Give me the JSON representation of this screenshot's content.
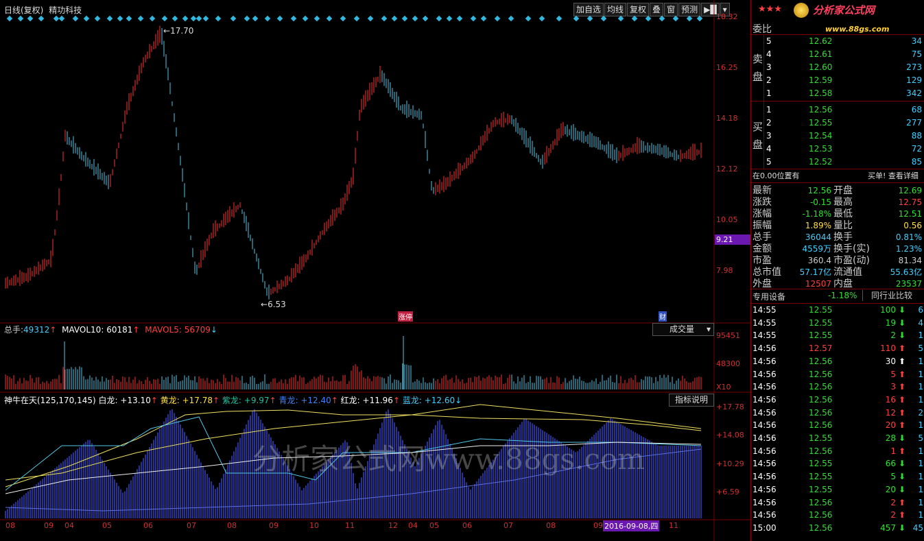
{
  "header": {
    "title": "日线(复权)",
    "stock_name": "精功科技",
    "buttons": [
      "加自选",
      "均线",
      "复权",
      "叠",
      "窗",
      "预测"
    ],
    "brand": "分析家公式网",
    "brand_url": "www.88gs.com"
  },
  "price_axis": [
    "18.32",
    "16.25",
    "14.18",
    "12.12",
    "10.05",
    "7.98"
  ],
  "cursor_price": "9.21",
  "annotations": {
    "high": "17.70",
    "low": "6.53",
    "zhangting": "涨停",
    "cai": "财"
  },
  "volume_panel": {
    "label_prefix": "总手:",
    "total": "49312",
    "mavol10_label": "MAVOL10:",
    "mavol10": "60181",
    "mavol5_label": "MAVOL5:",
    "mavol5": "56709",
    "dropdown": "成交量",
    "axis": [
      "95451",
      "48300"
    ],
    "scale": "X10"
  },
  "indicator_panel": {
    "name": "神牛在天(125,170,145)",
    "bailong_label": "白龙:",
    "bailong": "+13.10",
    "huanglong_label": "黄龙:",
    "huanglong": "+17.78",
    "zilong_label": "紫龙:",
    "zilong": "+9.97",
    "qinglong_label": "青龙:",
    "qinglong": "+12.40",
    "honglong_label": "红龙:",
    "honglong": "+11.96",
    "lanlong_label": "蓝龙:",
    "lanlong": "+12.60",
    "help_button": "指标说明",
    "axis": [
      "+17.78",
      "+14.08",
      "+10.29",
      "+6.59"
    ],
    "watermark": "分析家公式网www.88gs.com"
  },
  "date_axis": [
    "08",
    "09",
    "04",
    "05",
    "06",
    "07",
    "08",
    "09",
    "10",
    "11",
    "12",
    "04",
    "05",
    "06",
    "07",
    "08",
    "09",
    "11"
  ],
  "date_cursor": "2016-09-08,四",
  "order_book": {
    "header": "委比",
    "sell_label": "卖盘",
    "buy_label": "买盘",
    "sell": [
      {
        "level": "5",
        "price": "12.62",
        "vol": "34"
      },
      {
        "level": "4",
        "price": "12.61",
        "vol": "75"
      },
      {
        "level": "3",
        "price": "12.60",
        "vol": "273"
      },
      {
        "level": "2",
        "price": "12.59",
        "vol": "129"
      },
      {
        "level": "1",
        "price": "12.58",
        "vol": "342"
      }
    ],
    "buy": [
      {
        "level": "1",
        "price": "12.56",
        "vol": "68"
      },
      {
        "level": "2",
        "price": "12.55",
        "vol": "277"
      },
      {
        "level": "3",
        "price": "12.54",
        "vol": "88"
      },
      {
        "level": "4",
        "price": "12.53",
        "vol": "72"
      },
      {
        "level": "5",
        "price": "12.52",
        "vol": "85"
      }
    ],
    "note_left": "在0.00位置有",
    "note_right": "买单! 查看详细"
  },
  "quote": [
    {
      "l1": "最新",
      "v1": "12.56",
      "c1": "green",
      "l2": "开盘",
      "v2": "12.69",
      "c2": "green"
    },
    {
      "l1": "涨跌",
      "v1": "-0.15",
      "c1": "green",
      "l2": "最高",
      "v2": "12.75",
      "c2": "red"
    },
    {
      "l1": "涨幅",
      "v1": "-1.18%",
      "c1": "green",
      "l2": "最低",
      "v2": "12.51",
      "c2": "green"
    },
    {
      "l1": "振幅",
      "v1": "1.89%",
      "c1": "yellow",
      "l2": "量比",
      "v2": "0.56",
      "c2": "yellow"
    },
    {
      "l1": "总手",
      "v1": "36044",
      "c1": "cyan",
      "l2": "换手",
      "v2": "0.81%",
      "c2": "cyan"
    },
    {
      "l1": "金额",
      "v1": "4559万",
      "c1": "cyan",
      "l2": "换手(实)",
      "v2": "1.23%",
      "c2": "cyan"
    },
    {
      "l1": "市盈",
      "v1": "360.4",
      "c1": "gray",
      "l2": "市盈(动)",
      "v2": "81.34",
      "c2": "gray"
    },
    {
      "l1": "总市值",
      "v1": "57.17亿",
      "c1": "cyan",
      "l2": "流通值",
      "v2": "55.63亿",
      "c2": "cyan"
    },
    {
      "l1": "外盘",
      "v1": "12507",
      "c1": "red",
      "l2": "内盘",
      "v2": "23537",
      "c2": "green"
    }
  ],
  "sector": {
    "name": "专用设备",
    "change": "-1.18%",
    "compare_button": "同行业比较"
  },
  "ticks": [
    {
      "time": "14:55",
      "price": "12.55",
      "vol": "100",
      "dir": "down",
      "n": "6"
    },
    {
      "time": "14:55",
      "price": "12.55",
      "vol": "19",
      "dir": "down",
      "n": "4"
    },
    {
      "time": "14:55",
      "price": "12.55",
      "vol": "2",
      "dir": "down",
      "n": "1"
    },
    {
      "time": "14:56",
      "price": "12.57",
      "vol": "110",
      "dir": "up",
      "n": "5"
    },
    {
      "time": "14:56",
      "price": "12.56",
      "vol": "30",
      "dir": "white",
      "n": "1"
    },
    {
      "time": "14:56",
      "price": "12.56",
      "vol": "5",
      "dir": "up",
      "n": "1"
    },
    {
      "time": "14:56",
      "price": "12.56",
      "vol": "3",
      "dir": "up",
      "n": "1"
    },
    {
      "time": "14:56",
      "price": "12.56",
      "vol": "16",
      "dir": "up",
      "n": "1"
    },
    {
      "time": "14:56",
      "price": "12.56",
      "vol": "12",
      "dir": "up",
      "n": "2"
    },
    {
      "time": "14:56",
      "price": "12.56",
      "vol": "20",
      "dir": "up",
      "n": "1"
    },
    {
      "time": "14:56",
      "price": "12.55",
      "vol": "28",
      "dir": "down",
      "n": "5"
    },
    {
      "time": "14:56",
      "price": "12.56",
      "vol": "1",
      "dir": "up",
      "n": "1"
    },
    {
      "time": "14:56",
      "price": "12.55",
      "vol": "66",
      "dir": "down",
      "n": "1"
    },
    {
      "time": "14:56",
      "price": "12.55",
      "vol": "5",
      "dir": "down",
      "n": "1"
    },
    {
      "time": "14:56",
      "price": "12.55",
      "vol": "20",
      "dir": "down",
      "n": "1"
    },
    {
      "time": "14:56",
      "price": "12.56",
      "vol": "2",
      "dir": "up",
      "n": "1"
    },
    {
      "time": "14:56",
      "price": "12.56",
      "vol": "2",
      "dir": "up",
      "n": "1"
    },
    {
      "time": "15:00",
      "price": "12.56",
      "vol": "457",
      "dir": "down",
      "n": "45"
    }
  ]
}
